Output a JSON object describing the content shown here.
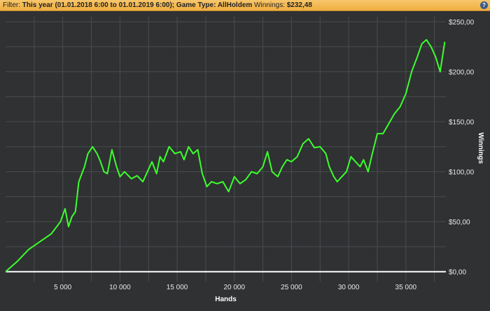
{
  "filter": {
    "prefix": "Filter: ",
    "text": "This year (01.01.2018 6:00 to 01.01.2019 6:00); Game Type: AllHoldem",
    "winnings_label": " Winnings: ",
    "winnings_value": "$232,48",
    "help_label": "?"
  },
  "colors": {
    "background": "#2f3133",
    "grid": "#4a4c4f",
    "series": "#3cff2c",
    "zero_line": "#ffffff"
  },
  "chart_data": {
    "type": "line",
    "xlabel": "Hands",
    "ylabel": "Winnings",
    "xlim": [
      0,
      38500
    ],
    "ylim": [
      -10,
      255
    ],
    "xticks": [
      5000,
      10000,
      15000,
      20000,
      25000,
      30000,
      35000
    ],
    "xtick_labels": [
      "5 000",
      "10 000",
      "15 000",
      "20 000",
      "25 000",
      "30 000",
      "35 000"
    ],
    "yticks": [
      0,
      50,
      100,
      150,
      200,
      250
    ],
    "ytick_labels": [
      "$0,00",
      "$50,00",
      "$100,00",
      "$150,00",
      "$200,00",
      "$250,00"
    ],
    "grid": true,
    "series": [
      {
        "values": [
          [
            0,
            0
          ],
          [
            1000,
            10
          ],
          [
            2000,
            22
          ],
          [
            3000,
            30
          ],
          [
            4000,
            38
          ],
          [
            4800,
            50
          ],
          [
            5200,
            63
          ],
          [
            5500,
            45
          ],
          [
            5800,
            55
          ],
          [
            6100,
            60
          ],
          [
            6400,
            90
          ],
          [
            6900,
            105
          ],
          [
            7200,
            118
          ],
          [
            7600,
            125
          ],
          [
            8000,
            118
          ],
          [
            8300,
            110
          ],
          [
            8600,
            100
          ],
          [
            8900,
            98
          ],
          [
            9300,
            122
          ],
          [
            9700,
            105
          ],
          [
            10000,
            95
          ],
          [
            10400,
            100
          ],
          [
            11000,
            93
          ],
          [
            11500,
            96
          ],
          [
            12000,
            90
          ],
          [
            12400,
            100
          ],
          [
            12800,
            110
          ],
          [
            13200,
            98
          ],
          [
            13500,
            115
          ],
          [
            13800,
            110
          ],
          [
            14300,
            125
          ],
          [
            14800,
            118
          ],
          [
            15300,
            120
          ],
          [
            15600,
            112
          ],
          [
            16000,
            125
          ],
          [
            16400,
            118
          ],
          [
            16800,
            122
          ],
          [
            17200,
            98
          ],
          [
            17600,
            85
          ],
          [
            18000,
            90
          ],
          [
            18500,
            88
          ],
          [
            19000,
            90
          ],
          [
            19500,
            80
          ],
          [
            20000,
            95
          ],
          [
            20500,
            88
          ],
          [
            21000,
            92
          ],
          [
            21500,
            100
          ],
          [
            22000,
            98
          ],
          [
            22500,
            105
          ],
          [
            22900,
            120
          ],
          [
            23300,
            100
          ],
          [
            23800,
            95
          ],
          [
            24200,
            105
          ],
          [
            24600,
            112
          ],
          [
            25000,
            110
          ],
          [
            25500,
            115
          ],
          [
            26000,
            128
          ],
          [
            26500,
            133
          ],
          [
            27000,
            124
          ],
          [
            27500,
            125
          ],
          [
            28000,
            118
          ],
          [
            28300,
            105
          ],
          [
            28700,
            95
          ],
          [
            29000,
            90
          ],
          [
            29400,
            95
          ],
          [
            29800,
            100
          ],
          [
            30200,
            115
          ],
          [
            30600,
            110
          ],
          [
            31000,
            105
          ],
          [
            31300,
            112
          ],
          [
            31700,
            100
          ],
          [
            32000,
            115
          ],
          [
            32500,
            138
          ],
          [
            33000,
            138
          ],
          [
            33500,
            148
          ],
          [
            34000,
            158
          ],
          [
            34500,
            165
          ],
          [
            35000,
            178
          ],
          [
            35500,
            200
          ],
          [
            36000,
            215
          ],
          [
            36400,
            228
          ],
          [
            36800,
            232
          ],
          [
            37200,
            225
          ],
          [
            37600,
            215
          ],
          [
            38000,
            200
          ],
          [
            38400,
            230
          ]
        ]
      }
    ]
  }
}
